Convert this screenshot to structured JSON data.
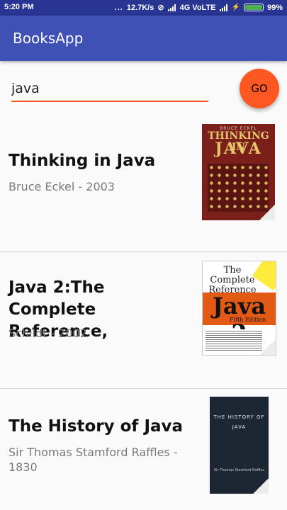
{
  "status_bar": {
    "time": "5:20 PM",
    "dots": "...",
    "speed": "12.7K/s",
    "network": "4G VoLTE",
    "battery": "99%"
  },
  "app": {
    "title": "BooksApp"
  },
  "search": {
    "value": "java",
    "button_label": "GO"
  },
  "books": [
    {
      "title": "Thinking in Java",
      "meta": "Bruce Eckel - 2003",
      "cover": {
        "author": "BRUCE ECKEL",
        "line1": "THINKING IN",
        "line2": "JAVA"
      }
    },
    {
      "title": "Java 2:The Complete Reference,",
      "meta": "Schildt - 2002",
      "cover": {
        "line1": "The Complete Reference",
        "line2": "Java 2",
        "edition": "Fifth Edition"
      }
    },
    {
      "title": "The History of Java",
      "meta": "Sir Thomas Stamford Raffles - 1830",
      "cover": {
        "line1": "THE HISTORY OF JAVA",
        "author": "Sir Thomas Stamford Raffles"
      }
    }
  ],
  "colors": {
    "status_bar": "#283593",
    "app_bar": "#3f51b5",
    "accent": "#ff5722"
  }
}
